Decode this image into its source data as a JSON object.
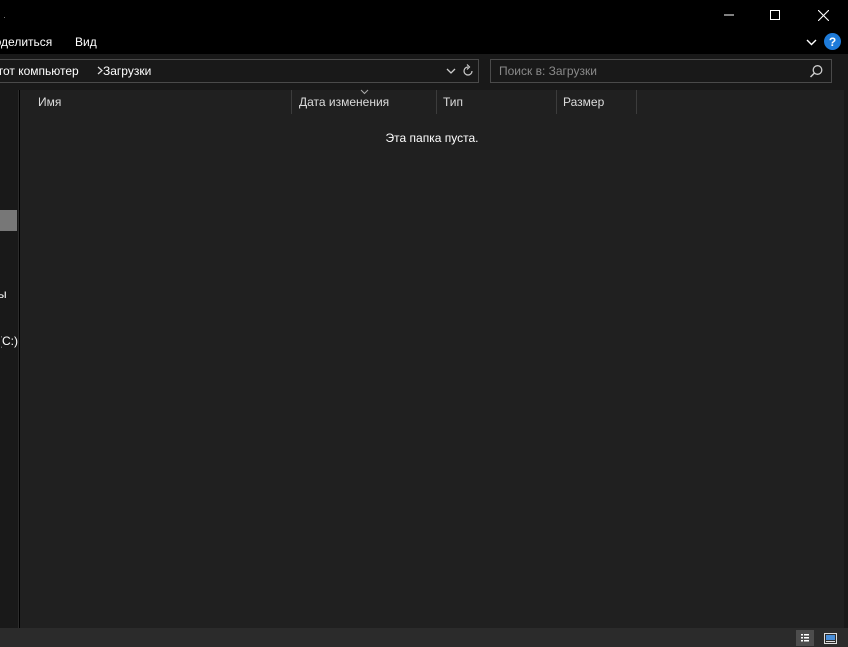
{
  "window": {
    "title_fragment": "а"
  },
  "ribbon": {
    "tabs": [
      {
        "label": "Поделиться"
      },
      {
        "label": "Вид"
      }
    ],
    "help_label": "?"
  },
  "address": {
    "breadcrumb": [
      {
        "label": "Этот компьютер"
      },
      {
        "label": "Загрузки"
      }
    ]
  },
  "search": {
    "placeholder": "Поиск в: Загрузки",
    "value": ""
  },
  "nav": {
    "fragments": [
      "ы",
      "(C:)"
    ]
  },
  "file_list": {
    "columns": [
      {
        "label": "Имя"
      },
      {
        "label": "Дата изменения"
      },
      {
        "label": "Тип"
      },
      {
        "label": "Размер"
      }
    ],
    "empty_message": "Эта папка пуста."
  },
  "colors": {
    "background": "#202020",
    "chrome": "#000000",
    "pane": "#191919",
    "accent": "#1e7bd9",
    "selection": "#777777"
  }
}
